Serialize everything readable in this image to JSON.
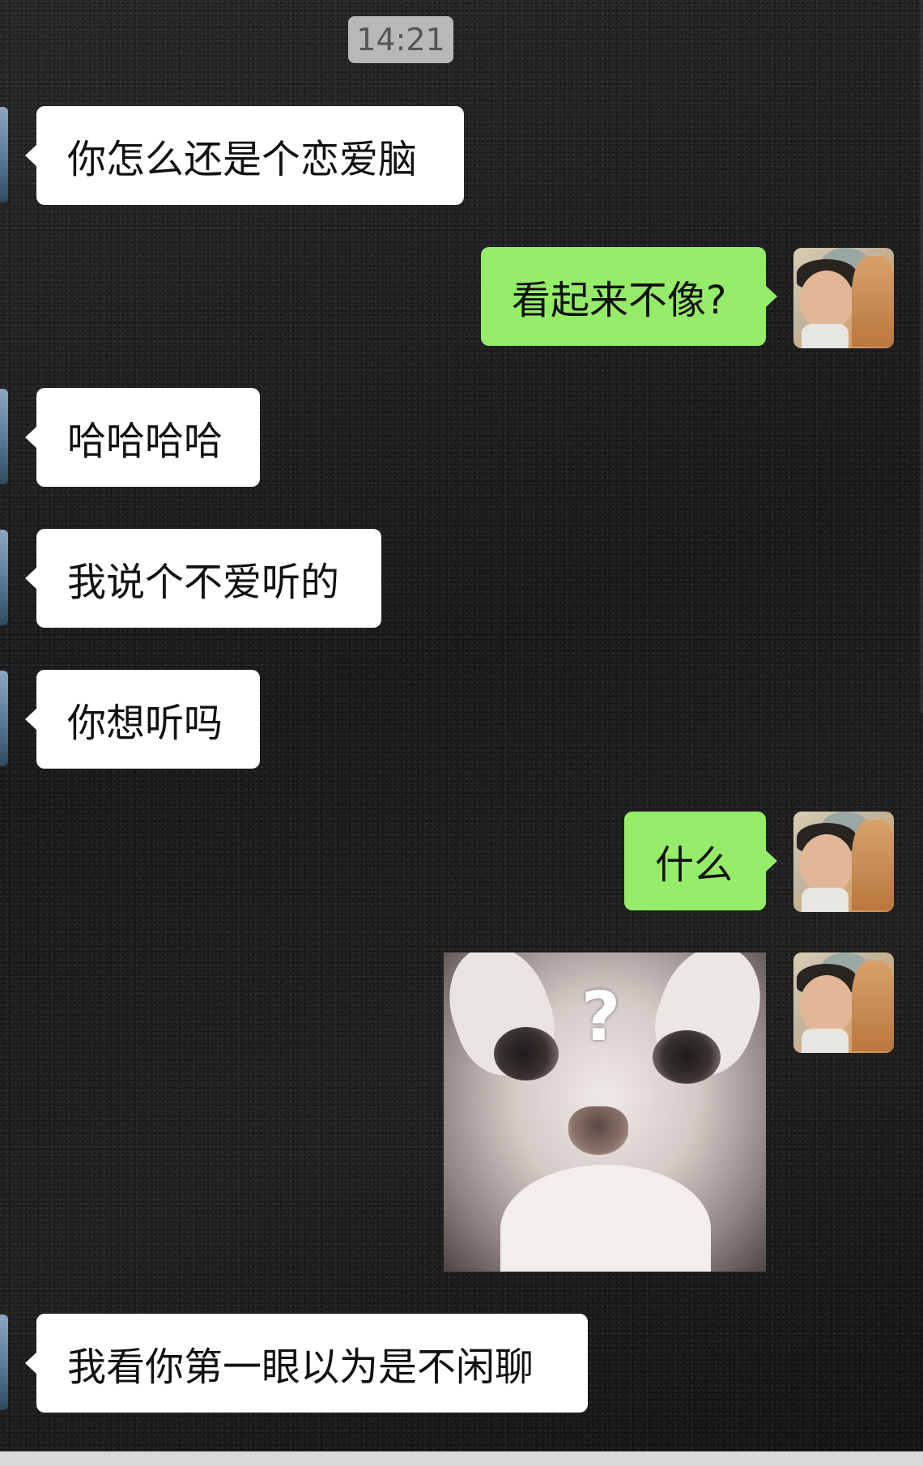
{
  "timestamp": "14:21",
  "messages": [
    {
      "side": "in",
      "text": "你怎么还是个恋爱脑"
    },
    {
      "side": "out",
      "text": "看起来不像?"
    },
    {
      "side": "in",
      "text": "哈哈哈哈"
    },
    {
      "side": "in",
      "text": "我说个不爱听的"
    },
    {
      "side": "in",
      "text": "你想听吗"
    },
    {
      "side": "out",
      "text": "什么"
    },
    {
      "side": "out",
      "image": "kitten-question-meme",
      "caption": "?"
    },
    {
      "side": "in",
      "text": "我看你第一眼以为是不闲聊"
    }
  ],
  "colors": {
    "incoming_bubble": "#ffffff",
    "outgoing_bubble": "#95ec69",
    "timestamp_bg": "#b8b8b8",
    "background": "#1f1f1f"
  }
}
